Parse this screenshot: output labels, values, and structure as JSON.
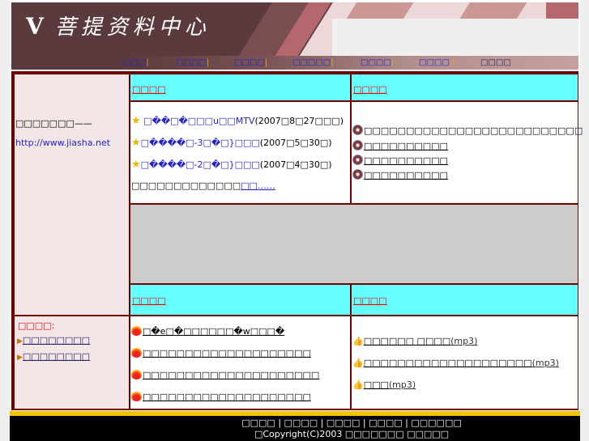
{
  "header": {
    "logo_text": "菩提资料中心"
  },
  "nav": [
    {
      "label": "□□□"
    },
    {
      "label": "□□□□"
    },
    {
      "label": "□□□□"
    },
    {
      "label": "□□□□□"
    },
    {
      "label": "□□□□"
    },
    {
      "label": "□□□□"
    },
    {
      "label": "□□□□"
    }
  ],
  "sidebar": {
    "intro": "□□□□□□□——",
    "url": "http://www.jiasha.net",
    "links_title": "□□□□:",
    "links": [
      "□□□□□□□□",
      "□□□□□□□□"
    ]
  },
  "sections": {
    "top_left": {
      "title": "□□□□",
      "items": [
        {
          "link": "□��□�□□□u□□MTV",
          "date": "(2007□8□27□□□)"
        },
        {
          "link": "□����□-3□�□}□□□",
          "date": "(2007□5□30□)"
        },
        {
          "link": "□����□-2□�□}□□□",
          "date": "(2007□4□30□)"
        }
      ],
      "more_text": "□□□□□□□□□□□□□",
      "more_link": "□□……"
    },
    "top_right": {
      "title": "□□□□",
      "items": [
        "□□□□□□□□□□□□□□□□□□□□□□□□□□",
        "□□□□□□□□□□",
        "□□□□□□□□□□",
        "□□□□□□□□□□"
      ]
    },
    "bottom_left": {
      "title": "□□□□",
      "items": [
        "□�e□�□□□□□□�w□□□�",
        "□□□□□□□□□□□□□□□□□□□□",
        "□□□□□□□□□□□□□□□□□□□□□",
        "□□□□□□□□□□□□□□□□□□□□"
      ]
    },
    "bottom_right": {
      "title": "□□□□",
      "items": [
        {
          "name": "□□□□□□ □□□□",
          "ext": "(mp3)"
        },
        {
          "name": "□□□□□□□□□□□□□□□□□□□□",
          "ext": "(mp3)"
        },
        {
          "name": "□□□",
          "ext": "(mp3)"
        }
      ]
    }
  },
  "footer": {
    "links": [
      "□□□□",
      "□□□□",
      "□□□□",
      "□□□□",
      "□□□□□□"
    ],
    "copyright": "□Copyright(C)2003 □□□□□□□ □□□□□"
  }
}
